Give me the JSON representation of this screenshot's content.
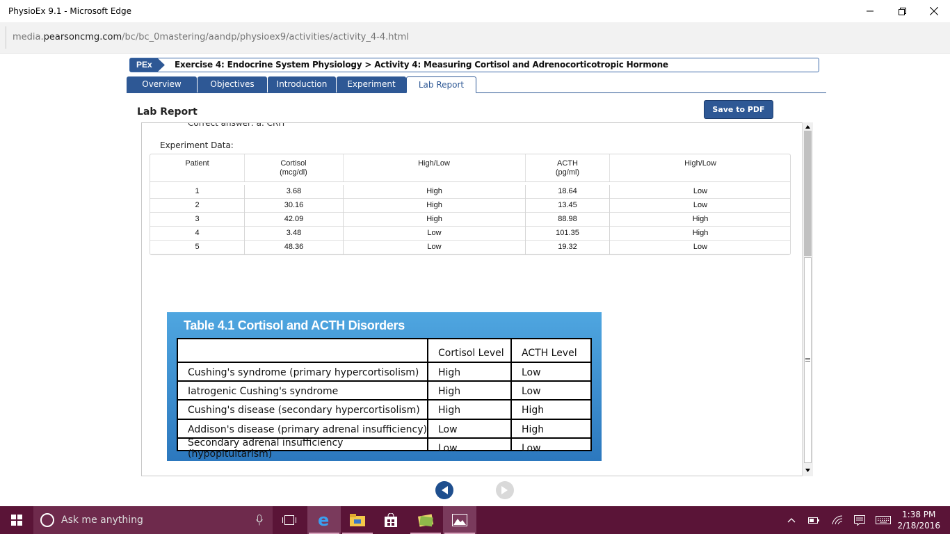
{
  "window": {
    "title": "PhysioEx 9.1 - Microsoft Edge"
  },
  "address": {
    "url_prefix": "media.",
    "url_domain": "pearsoncmg.com",
    "url_path": "/bc/bc_0mastering/aandp/physioex9/activities/activity_4-4.html"
  },
  "pex": {
    "badge": "PEx",
    "breadcrumb": "Exercise 4: Endocrine System Physiology > Activity 4: Measuring Cortisol and Adrenocorticotropic Hormone"
  },
  "tabs": [
    {
      "label": "Overview"
    },
    {
      "label": "Objectives"
    },
    {
      "label": "Introduction"
    },
    {
      "label": "Experiment"
    },
    {
      "label": "Lab Report"
    }
  ],
  "lab": {
    "title": "Lab Report",
    "save_label": "Save to PDF",
    "partial_text": "Correct answer: a. CRH",
    "experiment_label": "Experiment Data:"
  },
  "experiment_table": {
    "headers": {
      "patient": "Patient",
      "cortisol": "Cortisol",
      "cortisol_unit": "(mcg/dl)",
      "high_low_1": "High/Low",
      "acth": "ACTH",
      "acth_unit": "(pg/ml)",
      "high_low_2": "High/Low"
    },
    "rows": [
      {
        "patient": "1",
        "cortisol": "3.68",
        "cort_level": "High",
        "acth": "18.64",
        "acth_level": "Low"
      },
      {
        "patient": "2",
        "cortisol": "30.16",
        "cort_level": "High",
        "acth": "13.45",
        "acth_level": "Low"
      },
      {
        "patient": "3",
        "cortisol": "42.09",
        "cort_level": "High",
        "acth": "88.98",
        "acth_level": "High"
      },
      {
        "patient": "4",
        "cortisol": "3.48",
        "cort_level": "Low",
        "acth": "101.35",
        "acth_level": "High"
      },
      {
        "patient": "5",
        "cortisol": "48.36",
        "cort_level": "Low",
        "acth": "19.32",
        "acth_level": "Low"
      }
    ]
  },
  "disorders_table": {
    "title": "Table 4.1  Cortisol and ACTH Disorders",
    "headers": {
      "disorder": "",
      "cortisol": "Cortisol Level",
      "acth": "ACTH Level"
    },
    "rows": [
      {
        "disorder": "Cushing's syndrome (primary hypercortisolism)",
        "cortisol": "High",
        "acth": "Low"
      },
      {
        "disorder": "Iatrogenic Cushing's syndrome",
        "cortisol": "High",
        "acth": "Low"
      },
      {
        "disorder": "Cushing's disease (secondary hypercortisolism)",
        "cortisol": "High",
        "acth": "High"
      },
      {
        "disorder": "Addison's disease (primary adrenal insufficiency)",
        "cortisol": "Low",
        "acth": "High"
      },
      {
        "disorder": "Secondary adrenal insufficiency (hypopituitarism)",
        "cortisol": "Low",
        "acth": "Low"
      }
    ]
  },
  "taskbar": {
    "search_placeholder": "Ask me anything",
    "time": "1:38 PM",
    "date": "2/18/2016"
  },
  "colors": {
    "brand_blue": "#2e5895",
    "table_blue": "#3a8fd4",
    "taskbar": "#5a1437"
  }
}
